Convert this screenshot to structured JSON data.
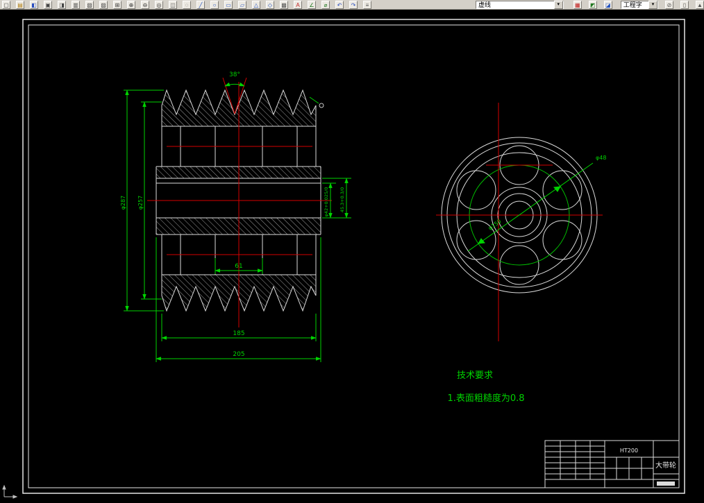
{
  "toolbar": {
    "icons_a": [
      {
        "n": "new-file-icon",
        "g": "▢",
        "c": "#444444"
      },
      {
        "n": "open-file-icon",
        "g": "▤",
        "c": "#b07d10"
      },
      {
        "n": "save-file-icon",
        "g": "◧",
        "c": "#2b4fc0"
      },
      {
        "n": "print-icon",
        "g": "▣",
        "c": "#444444"
      },
      {
        "n": "print-preview-icon",
        "g": "◨",
        "c": "#444444"
      },
      {
        "n": "cut-icon",
        "g": "▥",
        "c": "#444444"
      },
      {
        "n": "copy-icon",
        "g": "▧",
        "c": "#444444"
      },
      {
        "n": "paste-icon",
        "g": "▨",
        "c": "#444444"
      },
      {
        "n": "zoom-window-icon",
        "g": "⊞",
        "c": "#333333"
      },
      {
        "n": "zoom-in-icon",
        "g": "⊕",
        "c": "#333333"
      },
      {
        "n": "zoom-out-icon",
        "g": "⊖",
        "c": "#333333"
      },
      {
        "n": "zoom-all-icon",
        "g": "◎",
        "c": "#333333"
      },
      {
        "n": "pan-icon",
        "g": "◫",
        "c": "#555555"
      },
      {
        "n": "redraw-icon",
        "g": "◌",
        "c": "#555555"
      },
      {
        "n": "line-tool-icon",
        "g": "╱",
        "c": "#2050c0"
      },
      {
        "n": "circle-tool-icon",
        "g": "○",
        "c": "#2050c0"
      },
      {
        "n": "rectangle-tool-icon",
        "g": "▭",
        "c": "#2050c0"
      },
      {
        "n": "polygon-tool-icon",
        "g": "▱",
        "c": "#2050c0"
      },
      {
        "n": "spline-tool-icon",
        "g": "△",
        "c": "#2050c0"
      },
      {
        "n": "point-tool-icon",
        "g": "◇",
        "c": "#2050c0"
      },
      {
        "n": "hatch-tool-icon",
        "g": "▩",
        "c": "#555555"
      },
      {
        "n": "text-tool-icon",
        "g": "A",
        "c": "#c02020"
      },
      {
        "n": "angle-dim-icon",
        "g": "∠",
        "c": "#207820"
      },
      {
        "n": "diameter-dim-icon",
        "g": "⌀",
        "c": "#207820"
      },
      {
        "n": "undo-icon",
        "g": "↶",
        "c": "#2b4fc0"
      },
      {
        "n": "redo-icon",
        "g": "↷",
        "c": "#2b4fc0"
      },
      {
        "n": "layers-icon",
        "g": "≡",
        "c": "#555555"
      }
    ],
    "linetype": {
      "value": "虚线"
    },
    "icons_b": [
      {
        "n": "layer-color-icon",
        "g": "▦",
        "c": "#c02020"
      },
      {
        "n": "layer-state-icon",
        "g": "◩",
        "c": "#207820"
      },
      {
        "n": "layer-lock-icon",
        "g": "◪",
        "c": "#2050c0"
      }
    ],
    "textstyle": {
      "value": "工程字"
    },
    "icons_c": [
      {
        "n": "ortho-icon",
        "g": "⊘",
        "c": "#555555"
      },
      {
        "n": "properties-icon",
        "g": "▯",
        "c": "#555555"
      },
      {
        "n": "help-icon",
        "g": "▲",
        "c": "#555555"
      }
    ]
  },
  "drawing": {
    "section_view": {
      "dim_angle": "38°",
      "dim_outer": "φ287",
      "dim_pitch": "φ257",
      "dim_width_inner": "185",
      "dim_width_outer": "205",
      "dim_hole": "61",
      "dim_bore": "φ42+0.025/0",
      "dim_keyway": "45.3+0.3/0"
    },
    "front_view": {
      "dim_bolt_circle": "φ150",
      "dim_hole_dia": "φ48"
    },
    "tech_req": {
      "title": "技术要求",
      "line1": "1.表面粗糙度为0.8"
    },
    "title_block": {
      "material": "HT200",
      "part_name": "大带轮"
    }
  },
  "colors": {
    "dimension_green": "#00d400",
    "centerline_red": "#d40000",
    "outline_white": "#dcdcdc",
    "canvas_black": "#000000",
    "toolbar_gray": "#d4d0c8"
  }
}
